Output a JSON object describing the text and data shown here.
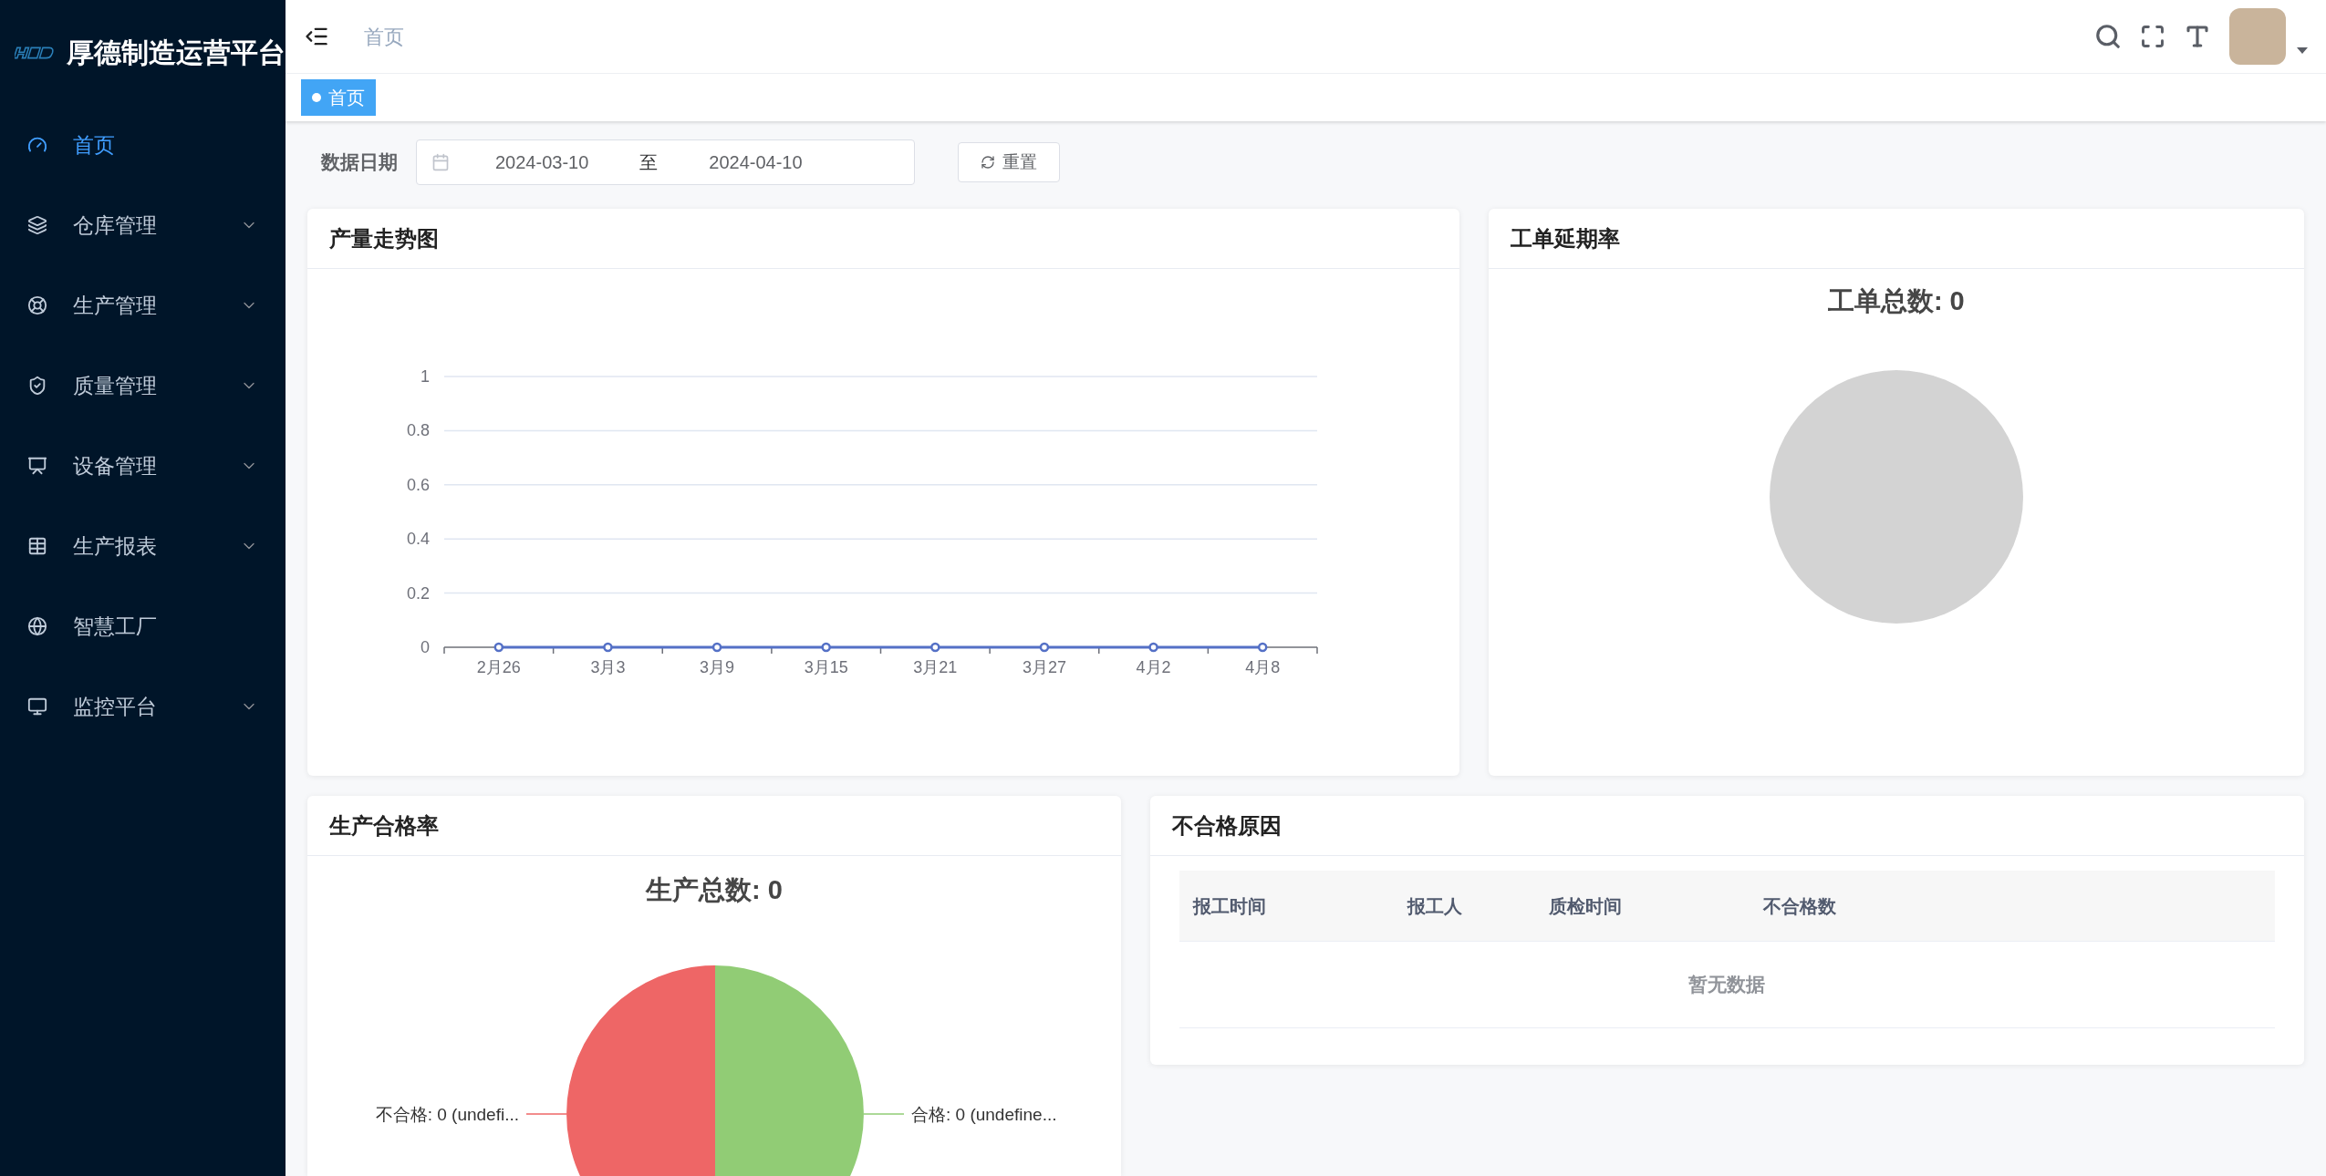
{
  "sidebar": {
    "title": "厚德制造运营平台",
    "items": [
      {
        "label": "首页",
        "kind": "link",
        "selected": true
      },
      {
        "label": "仓库管理",
        "kind": "submenu",
        "selected": false
      },
      {
        "label": "生产管理",
        "kind": "submenu",
        "selected": false
      },
      {
        "label": "质量管理",
        "kind": "submenu",
        "selected": false
      },
      {
        "label": "设备管理",
        "kind": "submenu",
        "selected": false
      },
      {
        "label": "生产报表",
        "kind": "submenu",
        "selected": false
      },
      {
        "label": "智慧工厂",
        "kind": "link",
        "selected": false
      },
      {
        "label": "监控平台",
        "kind": "submenu",
        "selected": false
      }
    ]
  },
  "header": {
    "breadcrumb": "首页"
  },
  "tags": [
    {
      "label": "首页",
      "selected": true
    }
  ],
  "filter": {
    "label": "数据日期",
    "start": "2024-03-10",
    "separator": "至",
    "end": "2024-04-10",
    "reset": "重置"
  },
  "output_trend": {
    "title": "产量走势图",
    "chart_data": {
      "type": "line",
      "categories": [
        "2月26",
        "3月3",
        "3月9",
        "3月15",
        "3月21",
        "3月27",
        "4月2",
        "4月8"
      ],
      "series": [
        {
          "color": "#5470c6",
          "marker": true,
          "values": [
            0,
            0,
            0,
            0,
            0,
            0,
            0,
            0
          ]
        }
      ],
      "grid": true,
      "ylim": [
        0,
        1
      ],
      "yticks": [
        0,
        0.2,
        0.4,
        0.6,
        0.8,
        1
      ]
    }
  },
  "delay_rate": {
    "title": "工单延期率",
    "total": "工单总数: 0"
  },
  "pass_rate": {
    "title": "生产合格率",
    "total": "生产总数: 0",
    "slices": [
      {
        "label": "不合格: 0 (undefi...",
        "color": "#ee6666"
      },
      {
        "label": "合格: 0 (undefine...",
        "color": "#91cc75"
      }
    ]
  },
  "defects": {
    "title": "不合格原因",
    "columns": [
      "报工时间",
      "报工人",
      "质检时间",
      "不合格数"
    ],
    "empty_text": "暂无数据"
  }
}
